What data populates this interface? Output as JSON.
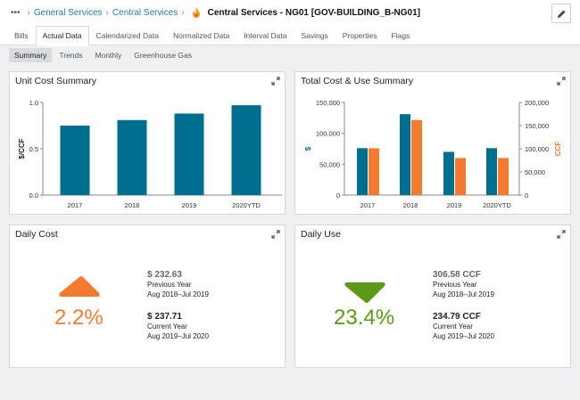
{
  "header": {
    "more": "•••",
    "breadcrumbs": [
      "General Services",
      "Central Services"
    ],
    "title": "Central Services - NG01 [GOV-BUILDING_B-NG01]",
    "icon": "flame-icon",
    "edit_icon": "pencil-icon"
  },
  "tabs": [
    {
      "label": "Bills"
    },
    {
      "label": "Actual Data",
      "active": true
    },
    {
      "label": "Calendarized Data"
    },
    {
      "label": "Normalized Data"
    },
    {
      "label": "Interval Data"
    },
    {
      "label": "Savings"
    },
    {
      "label": "Properties"
    },
    {
      "label": "Flags"
    }
  ],
  "subtabs": [
    {
      "label": "Summary",
      "active": true
    },
    {
      "label": "Trends"
    },
    {
      "label": "Monthly"
    },
    {
      "label": "Greenhouse Gas"
    }
  ],
  "colors": {
    "cost": "#006e8f",
    "use": "#f47a30",
    "up": "#f47a30",
    "down": "#5a9a17",
    "link": "#1a7fa8"
  },
  "chart_data": [
    {
      "type": "bar",
      "title": "Unit Cost Summary",
      "ylabel": "$/CCF",
      "categories": [
        "2017",
        "2018",
        "2019",
        "2020YTD"
      ],
      "values": [
        0.75,
        0.81,
        0.88,
        0.97
      ],
      "ylim": [
        0,
        1
      ],
      "yticks": [
        "0.0",
        "0.5",
        "1.0"
      ],
      "grid": false
    },
    {
      "type": "bar",
      "title": "Total Cost & Use Summary",
      "ylabel": "$",
      "y2label": "CCF",
      "categories": [
        "2017",
        "2018",
        "2019",
        "2020YTD"
      ],
      "series": [
        {
          "axis": "left",
          "values": [
            76000,
            131000,
            70000,
            76000
          ]
        },
        {
          "axis": "right",
          "values": [
            101000,
            162000,
            80000,
            80000
          ]
        }
      ],
      "ylim": [
        0,
        150000
      ],
      "y2lim": [
        0,
        200000
      ],
      "yticks": [
        "0",
        "50,000",
        "100,000",
        "150,000"
      ],
      "y2ticks": [
        "0",
        "50,000",
        "100,000",
        "150,000",
        "200,000"
      ],
      "grid": false
    }
  ],
  "daily_cost": {
    "title": "Daily Cost",
    "direction": "up",
    "percent": "2.2%",
    "prev_value": "$ 232.63",
    "prev_label": "Previous Year",
    "prev_range": "Aug 2018–Jul 2019",
    "cur_value": "$ 237.71",
    "cur_label": "Current Year",
    "cur_range": "Aug 2019–Jul 2020"
  },
  "daily_use": {
    "title": "Daily Use",
    "direction": "down",
    "percent": "23.4%",
    "prev_value": "306.58 CCF",
    "prev_label": "Previous Year",
    "prev_range": "Aug 2018–Jul 2019",
    "cur_value": "234.79 CCF",
    "cur_label": "Current Year",
    "cur_range": "Aug 2019–Jul 2020"
  }
}
